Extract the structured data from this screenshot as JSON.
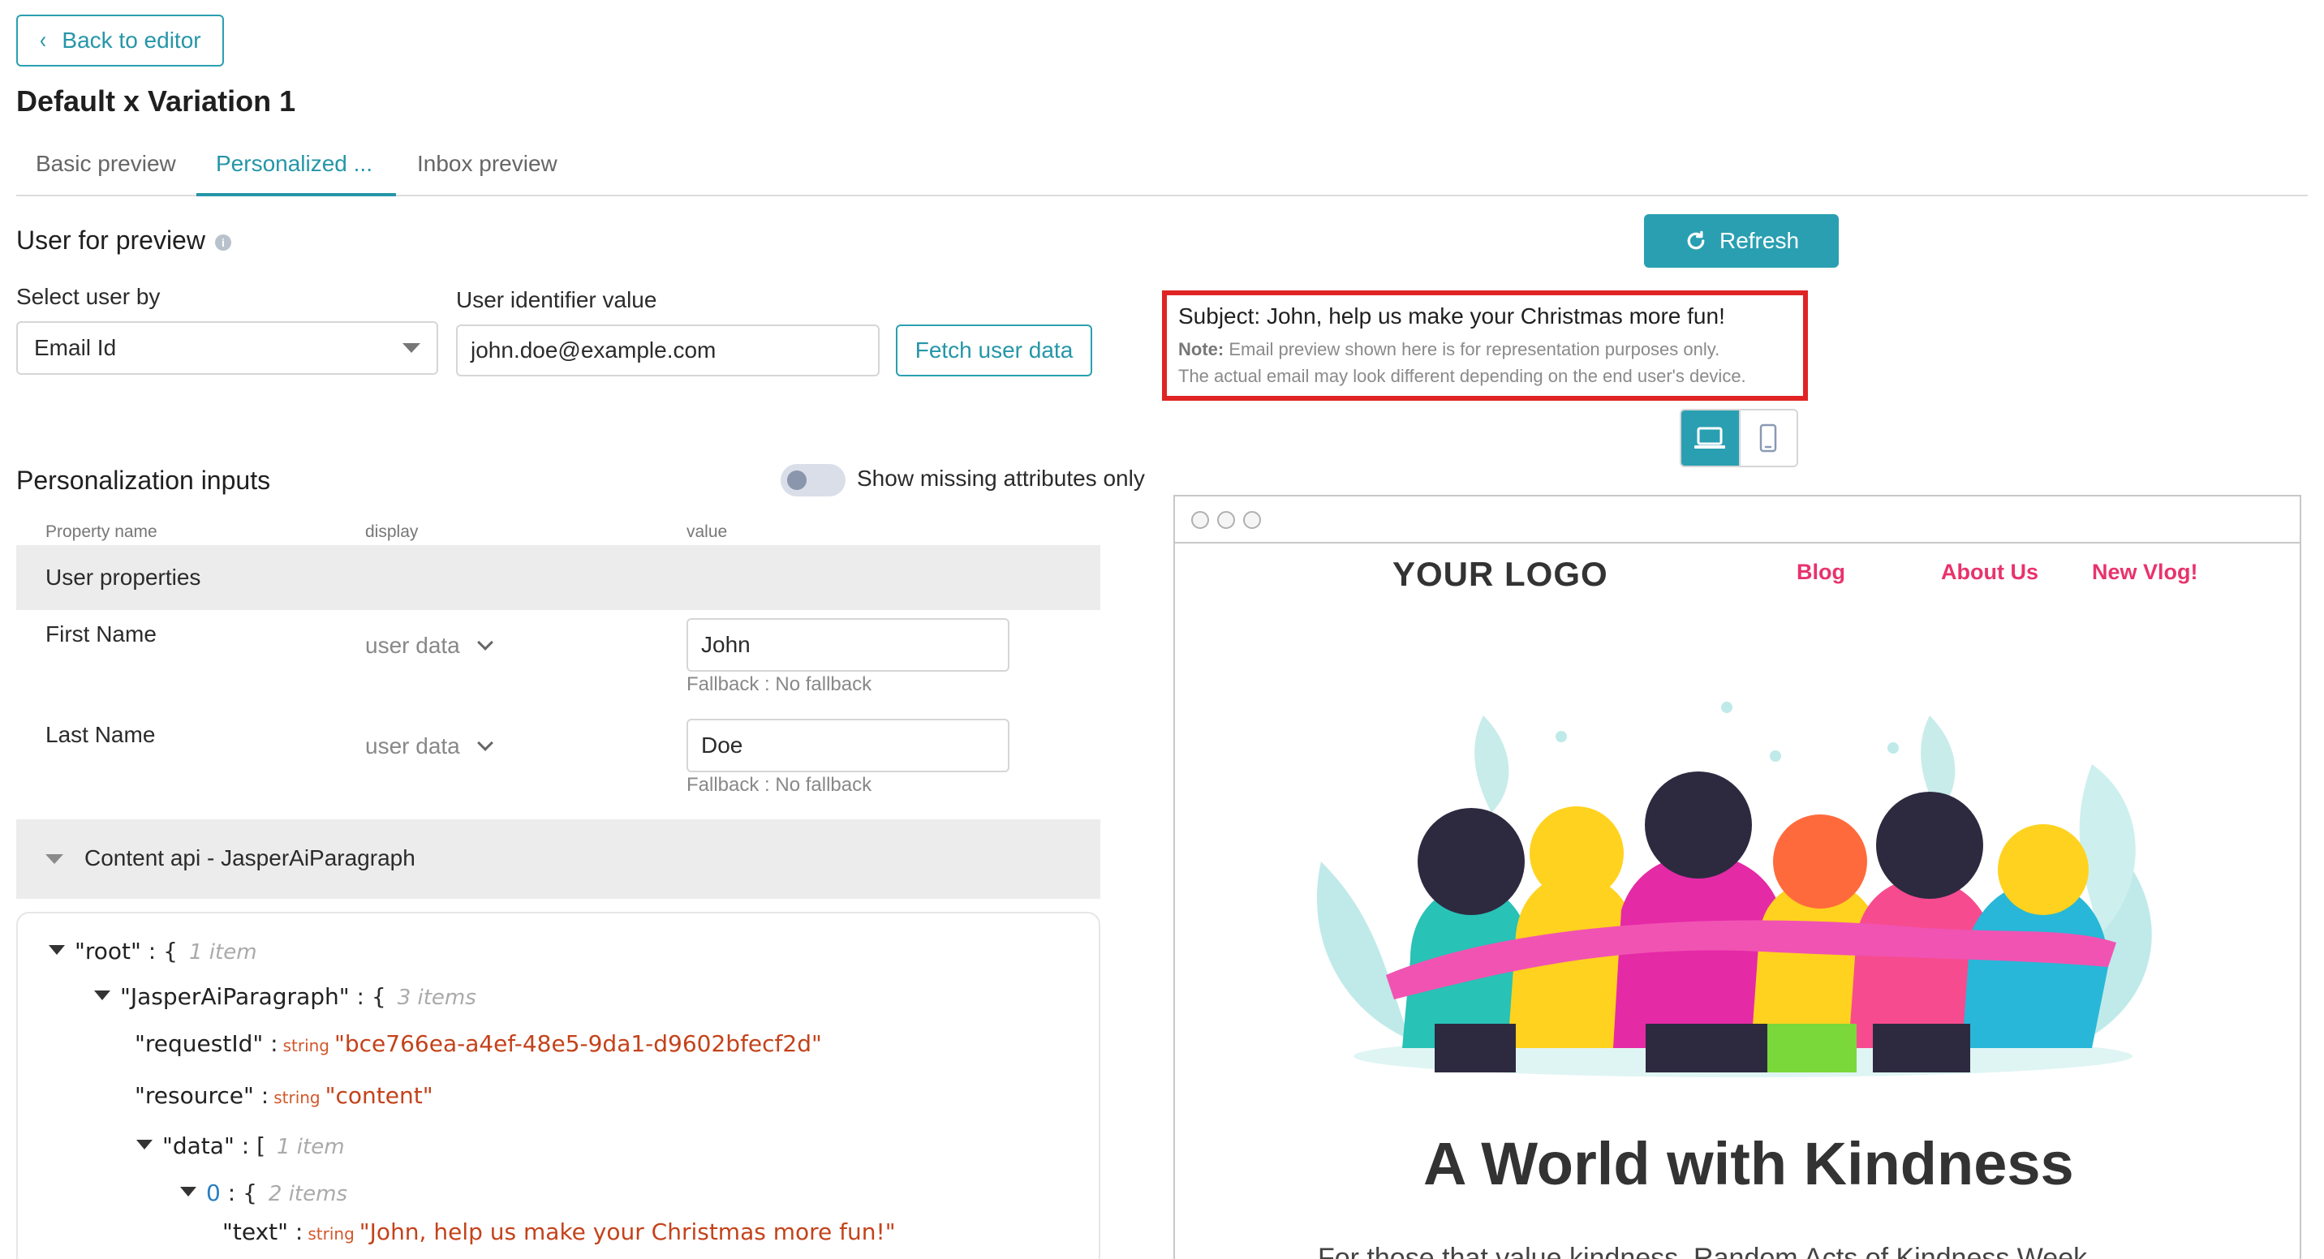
{
  "back_button": {
    "label": "Back to editor"
  },
  "page_title": "Default x Variation 1",
  "tabs": [
    {
      "label": "Basic preview",
      "active": false
    },
    {
      "label": "Personalized ...",
      "active": true
    },
    {
      "label": "Inbox preview",
      "active": false
    }
  ],
  "user_preview": {
    "title": "User for preview",
    "select_label": "Select user by",
    "select_value": "Email Id",
    "identifier_label": "User identifier value",
    "identifier_value": "john.doe@example.com",
    "fetch_label": "Fetch user data"
  },
  "personalization": {
    "title": "Personalization inputs",
    "toggle_label": "Show missing attributes only",
    "toggle_on": false,
    "columns": {
      "property": "Property name",
      "display": "display",
      "value": "value"
    },
    "user_properties_label": "User properties",
    "rows": [
      {
        "name": "First Name",
        "display": "user data",
        "value": "John",
        "fallback": "Fallback : No fallback"
      },
      {
        "name": "Last Name",
        "display": "user data",
        "value": "Doe",
        "fallback": "Fallback : No fallback"
      }
    ],
    "content_api_label": "Content api - JasperAiParagraph"
  },
  "json_viewer": {
    "root_key": "\"root\"",
    "root_count": "1 item",
    "jasper_key": "\"JasperAiParagraph\"",
    "jasper_count": "3 items",
    "request_key": "\"requestId\"",
    "request_type": "string",
    "request_value": "\"bce766ea-a4ef-48e5-9da1-d9602bfecf2d\"",
    "resource_key": "\"resource\"",
    "resource_type": "string",
    "resource_value": "\"content\"",
    "data_key": "\"data\"",
    "data_count": "1 item",
    "index_key": "0",
    "index_count": "2 items",
    "text_key": "\"text\"",
    "text_type": "string",
    "text_value": "\"John, help us make your Christmas more fun!\""
  },
  "preview": {
    "refresh_label": "Refresh",
    "subject": "Subject: John, help us make your Christmas more fun!",
    "note_label": "Note:",
    "note_text1": "Email preview shown here is for representation purposes only.",
    "note_text2": "The actual email may look different depending on the end user's device.",
    "device_active": "desktop"
  },
  "email": {
    "logo": "YOUR LOGO",
    "nav": [
      "Blog",
      "About Us",
      "New Vlog!"
    ],
    "headline": "A World with Kindness",
    "subline": "For those that value kindness, Random Acts of Kindness Week"
  },
  "colors": {
    "accent": "#2a9fb2",
    "highlight_border": "#e02424",
    "nav_link": "#e8336d"
  }
}
